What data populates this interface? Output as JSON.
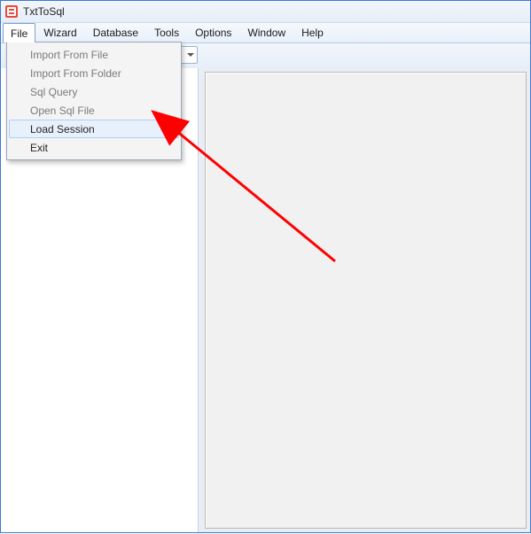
{
  "window": {
    "title": "TxtToSql"
  },
  "menubar": {
    "items": [
      {
        "label": "File",
        "open": true
      },
      {
        "label": "Wizard",
        "open": false
      },
      {
        "label": "Database",
        "open": false
      },
      {
        "label": "Tools",
        "open": false
      },
      {
        "label": "Options",
        "open": false
      },
      {
        "label": "Window",
        "open": false
      },
      {
        "label": "Help",
        "open": false
      }
    ]
  },
  "file_menu": {
    "items": [
      {
        "label": "Import From File",
        "enabled": false,
        "submenu": false,
        "hover": false
      },
      {
        "label": "Import From Folder",
        "enabled": false,
        "submenu": false,
        "hover": false
      },
      {
        "label": "Sql Query",
        "enabled": false,
        "submenu": false,
        "hover": false
      },
      {
        "label": "Open Sql File",
        "enabled": false,
        "submenu": false,
        "hover": false
      },
      {
        "label": "Load Session",
        "enabled": true,
        "submenu": true,
        "hover": true
      },
      {
        "label": "Exit",
        "enabled": true,
        "submenu": false,
        "hover": false
      }
    ]
  },
  "annotation": {
    "arrow_color": "#ff0000"
  }
}
